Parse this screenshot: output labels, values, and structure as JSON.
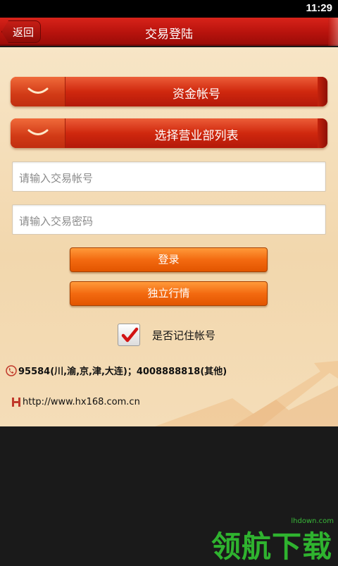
{
  "status_bar": {
    "time": "11:29"
  },
  "header": {
    "back_label": "返回",
    "title": "交易登陆"
  },
  "selectors": [
    {
      "label": "资金帐号",
      "icon": "chevron-down-icon"
    },
    {
      "label": "选择营业部列表",
      "icon": "chevron-down-icon"
    }
  ],
  "account_input": {
    "placeholder": "请输入交易帐号",
    "value": ""
  },
  "password_input": {
    "placeholder": "请输入交易密码",
    "value": ""
  },
  "buttons": {
    "login": "登录",
    "market": "独立行情"
  },
  "remember": {
    "label": "是否记住帐号",
    "checked": true
  },
  "footer": {
    "hotline": "95584(川,渝,京,津,大连)；4008888818(其他)",
    "website": "http://www.hx168.com.cn"
  },
  "watermark": {
    "text": "领航下载",
    "domain": "lhdown.com"
  },
  "colors": {
    "title_red": "#c61c14",
    "button_orange": "#f36a10",
    "check_red": "#d21414",
    "watermark_green": "#2fb32f"
  }
}
